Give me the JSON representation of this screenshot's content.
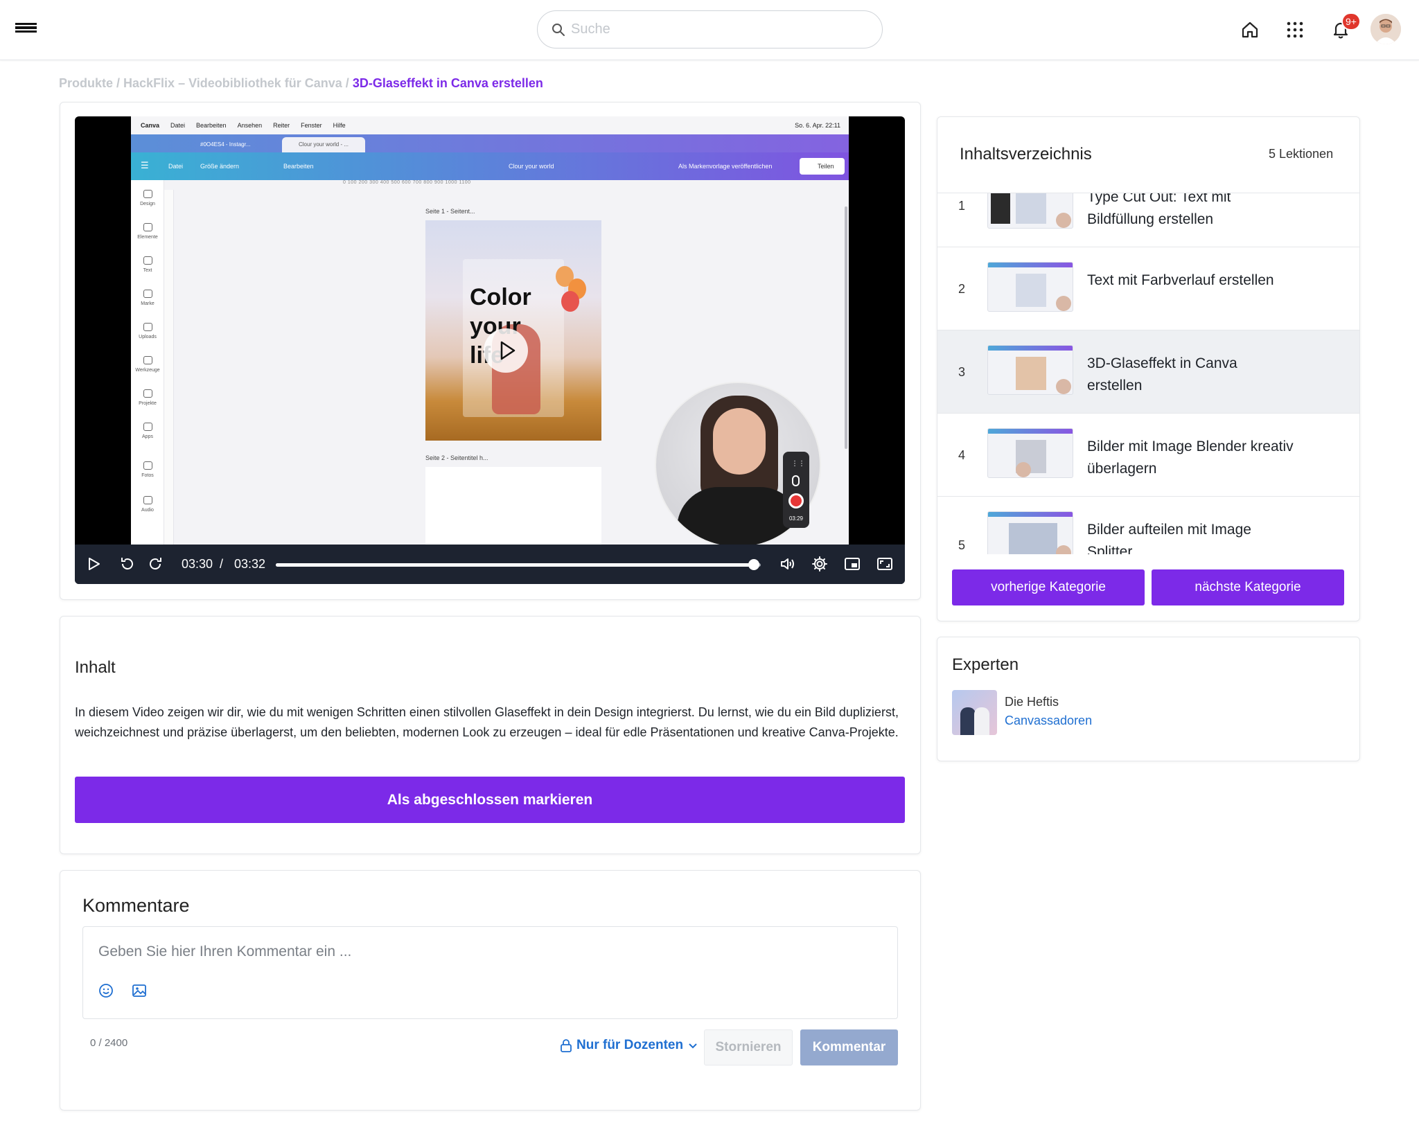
{
  "header": {
    "search_placeholder": "Suche",
    "notification_badge": "9+"
  },
  "breadcrumb": {
    "items": [
      "Produkte",
      "HackFlix – Videobibliothek für Canva"
    ],
    "current": "3D-Glaseffekt in Canva erstellen"
  },
  "video": {
    "current_time": "03:30",
    "separator": "/",
    "total_time": "03:32",
    "progress": 0.986,
    "screen": {
      "mac_app": "Canva",
      "mac_menu": [
        "Datei",
        "Bearbeiten",
        "Ansehen",
        "Reiter",
        "Fenster",
        "Hilfe"
      ],
      "mac_time": "So. 6. Apr. 22:11",
      "tabs": [
        "#0O4ES4 - Instagr...",
        "Clour your world - ..."
      ],
      "toolbar": [
        "Datei",
        "Größe ändern",
        "Bearbeiten"
      ],
      "toolbar_title": "Clour your world",
      "toolbar_publish": "Als Markenvorlage veröffentlichen",
      "toolbar_share": "Teilen",
      "ruler": "0   100  200  300  400  500  600  700  800  900  1000 1100",
      "side_items": [
        "Design",
        "Elemente",
        "Text",
        "Marke",
        "Uploads",
        "Werkzeuge",
        "Projekte",
        "Apps",
        "Fotos",
        "Audio"
      ],
      "page1_label": "Seite 1 - Seitent...",
      "page2_label": "Seite 2 - Seitentitel h...",
      "design_text": [
        "Color",
        "your",
        "life"
      ],
      "rec_time": "03:29"
    }
  },
  "content": {
    "title": "Inhalt",
    "text": "In diesem Video zeigen wir dir, wie du mit wenigen Schritten einen stilvollen Glaseffekt in dein Design integrierst. Du lernst, wie du ein Bild duplizierst, weichzeichnest und präzise überlagerst, um den beliebten, modernen Look zu erzeugen – ideal für edle Präsentationen und kreative Canva-Projekte.",
    "complete_button": "Als abgeschlossen markieren"
  },
  "comments": {
    "title": "Kommentare",
    "placeholder": "Geben Sie hier Ihren Kommentar ein ...",
    "counter": "0 / 2400",
    "visibility": "Nur für Dozenten",
    "cancel": "Stornieren",
    "submit": "Kommentar"
  },
  "toc": {
    "title": "Inhaltsverzeichnis",
    "count": "5 Lektionen",
    "items": [
      {
        "num": "1",
        "label": "Type Cut Out: Text mit Bildfüllung erstellen"
      },
      {
        "num": "2",
        "label": "Text mit Farbverlauf erstellen"
      },
      {
        "num": "3",
        "label": "3D-Glaseffekt in Canva erstellen"
      },
      {
        "num": "4",
        "label": "Bilder mit Image Blender kreativ überlagern"
      },
      {
        "num": "5",
        "label": "Bilder aufteilen mit Image Splitter"
      }
    ],
    "prev_button": "vorherige Kategorie",
    "next_button": "nächste Kategorie"
  },
  "experts": {
    "title": "Experten",
    "name": "Die Heftis",
    "link": "Canvassadoren"
  },
  "colors": {
    "accent": "#7c2ae8",
    "link": "#1f6fd1",
    "badge": "#e0362c",
    "submit_disabled": "#94a9cf"
  }
}
